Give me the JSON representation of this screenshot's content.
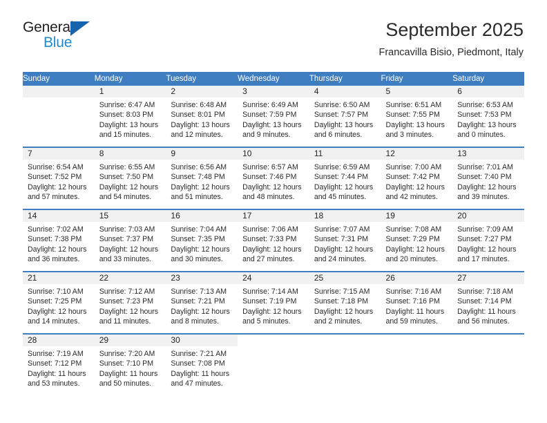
{
  "logo": {
    "primary_text": "General",
    "secondary_text": "Blue",
    "primary_color": "#221f1f",
    "secondary_color": "#1f8ad4",
    "triangle_color": "#1664ab"
  },
  "header": {
    "title": "September 2025",
    "subtitle": "Francavilla Bisio, Piedmont, Italy"
  },
  "colors": {
    "header_band": "#3d7dc0",
    "daynum_band": "#f1f1f1",
    "text": "#2a2a2a"
  },
  "weekday_headers": [
    "Sunday",
    "Monday",
    "Tuesday",
    "Wednesday",
    "Thursday",
    "Friday",
    "Saturday"
  ],
  "weeks": [
    [
      {
        "day": "",
        "sunrise": "",
        "sunset": "",
        "daylight_line1": "",
        "daylight_line2": ""
      },
      {
        "day": "1",
        "sunrise": "Sunrise: 6:47 AM",
        "sunset": "Sunset: 8:03 PM",
        "daylight_line1": "Daylight: 13 hours",
        "daylight_line2": "and 15 minutes."
      },
      {
        "day": "2",
        "sunrise": "Sunrise: 6:48 AM",
        "sunset": "Sunset: 8:01 PM",
        "daylight_line1": "Daylight: 13 hours",
        "daylight_line2": "and 12 minutes."
      },
      {
        "day": "3",
        "sunrise": "Sunrise: 6:49 AM",
        "sunset": "Sunset: 7:59 PM",
        "daylight_line1": "Daylight: 13 hours",
        "daylight_line2": "and 9 minutes."
      },
      {
        "day": "4",
        "sunrise": "Sunrise: 6:50 AM",
        "sunset": "Sunset: 7:57 PM",
        "daylight_line1": "Daylight: 13 hours",
        "daylight_line2": "and 6 minutes."
      },
      {
        "day": "5",
        "sunrise": "Sunrise: 6:51 AM",
        "sunset": "Sunset: 7:55 PM",
        "daylight_line1": "Daylight: 13 hours",
        "daylight_line2": "and 3 minutes."
      },
      {
        "day": "6",
        "sunrise": "Sunrise: 6:53 AM",
        "sunset": "Sunset: 7:53 PM",
        "daylight_line1": "Daylight: 13 hours",
        "daylight_line2": "and 0 minutes."
      }
    ],
    [
      {
        "day": "7",
        "sunrise": "Sunrise: 6:54 AM",
        "sunset": "Sunset: 7:52 PM",
        "daylight_line1": "Daylight: 12 hours",
        "daylight_line2": "and 57 minutes."
      },
      {
        "day": "8",
        "sunrise": "Sunrise: 6:55 AM",
        "sunset": "Sunset: 7:50 PM",
        "daylight_line1": "Daylight: 12 hours",
        "daylight_line2": "and 54 minutes."
      },
      {
        "day": "9",
        "sunrise": "Sunrise: 6:56 AM",
        "sunset": "Sunset: 7:48 PM",
        "daylight_line1": "Daylight: 12 hours",
        "daylight_line2": "and 51 minutes."
      },
      {
        "day": "10",
        "sunrise": "Sunrise: 6:57 AM",
        "sunset": "Sunset: 7:46 PM",
        "daylight_line1": "Daylight: 12 hours",
        "daylight_line2": "and 48 minutes."
      },
      {
        "day": "11",
        "sunrise": "Sunrise: 6:59 AM",
        "sunset": "Sunset: 7:44 PM",
        "daylight_line1": "Daylight: 12 hours",
        "daylight_line2": "and 45 minutes."
      },
      {
        "day": "12",
        "sunrise": "Sunrise: 7:00 AM",
        "sunset": "Sunset: 7:42 PM",
        "daylight_line1": "Daylight: 12 hours",
        "daylight_line2": "and 42 minutes."
      },
      {
        "day": "13",
        "sunrise": "Sunrise: 7:01 AM",
        "sunset": "Sunset: 7:40 PM",
        "daylight_line1": "Daylight: 12 hours",
        "daylight_line2": "and 39 minutes."
      }
    ],
    [
      {
        "day": "14",
        "sunrise": "Sunrise: 7:02 AM",
        "sunset": "Sunset: 7:38 PM",
        "daylight_line1": "Daylight: 12 hours",
        "daylight_line2": "and 36 minutes."
      },
      {
        "day": "15",
        "sunrise": "Sunrise: 7:03 AM",
        "sunset": "Sunset: 7:37 PM",
        "daylight_line1": "Daylight: 12 hours",
        "daylight_line2": "and 33 minutes."
      },
      {
        "day": "16",
        "sunrise": "Sunrise: 7:04 AM",
        "sunset": "Sunset: 7:35 PM",
        "daylight_line1": "Daylight: 12 hours",
        "daylight_line2": "and 30 minutes."
      },
      {
        "day": "17",
        "sunrise": "Sunrise: 7:06 AM",
        "sunset": "Sunset: 7:33 PM",
        "daylight_line1": "Daylight: 12 hours",
        "daylight_line2": "and 27 minutes."
      },
      {
        "day": "18",
        "sunrise": "Sunrise: 7:07 AM",
        "sunset": "Sunset: 7:31 PM",
        "daylight_line1": "Daylight: 12 hours",
        "daylight_line2": "and 24 minutes."
      },
      {
        "day": "19",
        "sunrise": "Sunrise: 7:08 AM",
        "sunset": "Sunset: 7:29 PM",
        "daylight_line1": "Daylight: 12 hours",
        "daylight_line2": "and 20 minutes."
      },
      {
        "day": "20",
        "sunrise": "Sunrise: 7:09 AM",
        "sunset": "Sunset: 7:27 PM",
        "daylight_line1": "Daylight: 12 hours",
        "daylight_line2": "and 17 minutes."
      }
    ],
    [
      {
        "day": "21",
        "sunrise": "Sunrise: 7:10 AM",
        "sunset": "Sunset: 7:25 PM",
        "daylight_line1": "Daylight: 12 hours",
        "daylight_line2": "and 14 minutes."
      },
      {
        "day": "22",
        "sunrise": "Sunrise: 7:12 AM",
        "sunset": "Sunset: 7:23 PM",
        "daylight_line1": "Daylight: 12 hours",
        "daylight_line2": "and 11 minutes."
      },
      {
        "day": "23",
        "sunrise": "Sunrise: 7:13 AM",
        "sunset": "Sunset: 7:21 PM",
        "daylight_line1": "Daylight: 12 hours",
        "daylight_line2": "and 8 minutes."
      },
      {
        "day": "24",
        "sunrise": "Sunrise: 7:14 AM",
        "sunset": "Sunset: 7:19 PM",
        "daylight_line1": "Daylight: 12 hours",
        "daylight_line2": "and 5 minutes."
      },
      {
        "day": "25",
        "sunrise": "Sunrise: 7:15 AM",
        "sunset": "Sunset: 7:18 PM",
        "daylight_line1": "Daylight: 12 hours",
        "daylight_line2": "and 2 minutes."
      },
      {
        "day": "26",
        "sunrise": "Sunrise: 7:16 AM",
        "sunset": "Sunset: 7:16 PM",
        "daylight_line1": "Daylight: 11 hours",
        "daylight_line2": "and 59 minutes."
      },
      {
        "day": "27",
        "sunrise": "Sunrise: 7:18 AM",
        "sunset": "Sunset: 7:14 PM",
        "daylight_line1": "Daylight: 11 hours",
        "daylight_line2": "and 56 minutes."
      }
    ],
    [
      {
        "day": "28",
        "sunrise": "Sunrise: 7:19 AM",
        "sunset": "Sunset: 7:12 PM",
        "daylight_line1": "Daylight: 11 hours",
        "daylight_line2": "and 53 minutes."
      },
      {
        "day": "29",
        "sunrise": "Sunrise: 7:20 AM",
        "sunset": "Sunset: 7:10 PM",
        "daylight_line1": "Daylight: 11 hours",
        "daylight_line2": "and 50 minutes."
      },
      {
        "day": "30",
        "sunrise": "Sunrise: 7:21 AM",
        "sunset": "Sunset: 7:08 PM",
        "daylight_line1": "Daylight: 11 hours",
        "daylight_line2": "and 47 minutes."
      },
      {
        "day": "",
        "sunrise": "",
        "sunset": "",
        "daylight_line1": "",
        "daylight_line2": ""
      },
      {
        "day": "",
        "sunrise": "",
        "sunset": "",
        "daylight_line1": "",
        "daylight_line2": ""
      },
      {
        "day": "",
        "sunrise": "",
        "sunset": "",
        "daylight_line1": "",
        "daylight_line2": ""
      },
      {
        "day": "",
        "sunrise": "",
        "sunset": "",
        "daylight_line1": "",
        "daylight_line2": ""
      }
    ]
  ]
}
